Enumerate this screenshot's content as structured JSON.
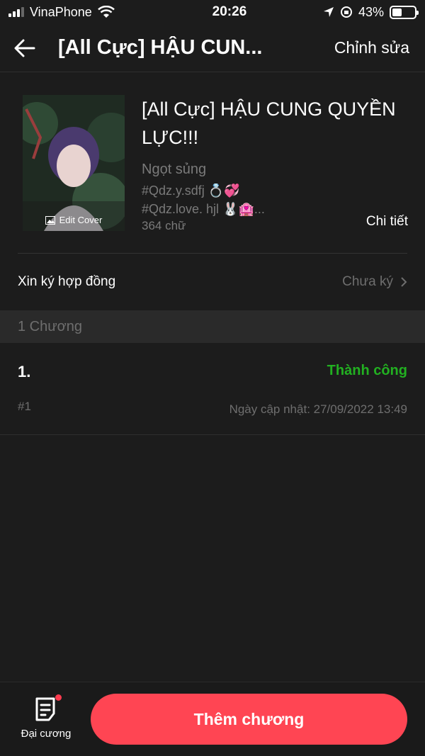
{
  "status_bar": {
    "carrier": "VinaPhone",
    "time": "20:26",
    "battery": "43%",
    "battery_level": 0.43
  },
  "nav": {
    "title": "[All Cực] HẬU CUN...",
    "edit_label": "Chỉnh sửa"
  },
  "book": {
    "cover_label": "Edit Cover",
    "title": "[All Cực] HẬU CUNG QUYỀN LỰC!!!",
    "subtitle": "Ngọt sủng",
    "tag1": "#Qdz.y.sdfj 💍💞",
    "tag2": "#Qdz.love. hjl 🐰🏩...",
    "word_count": "364 chữ",
    "detail_label": "Chi tiết"
  },
  "contract": {
    "label": "Xin ký hợp đồng",
    "status": "Chưa ký"
  },
  "chapters": {
    "header": "1 Chương",
    "items": [
      {
        "title": "1.",
        "status": "Thành công",
        "number": "#1",
        "updated": "Ngày cập nhật: 27/09/2022 13:49"
      }
    ]
  },
  "bottom": {
    "outline_label": "Đại cương",
    "add_label": "Thêm chương"
  },
  "colors": {
    "accent": "#ff4553",
    "success": "#22b021",
    "background": "#1c1c1c"
  }
}
